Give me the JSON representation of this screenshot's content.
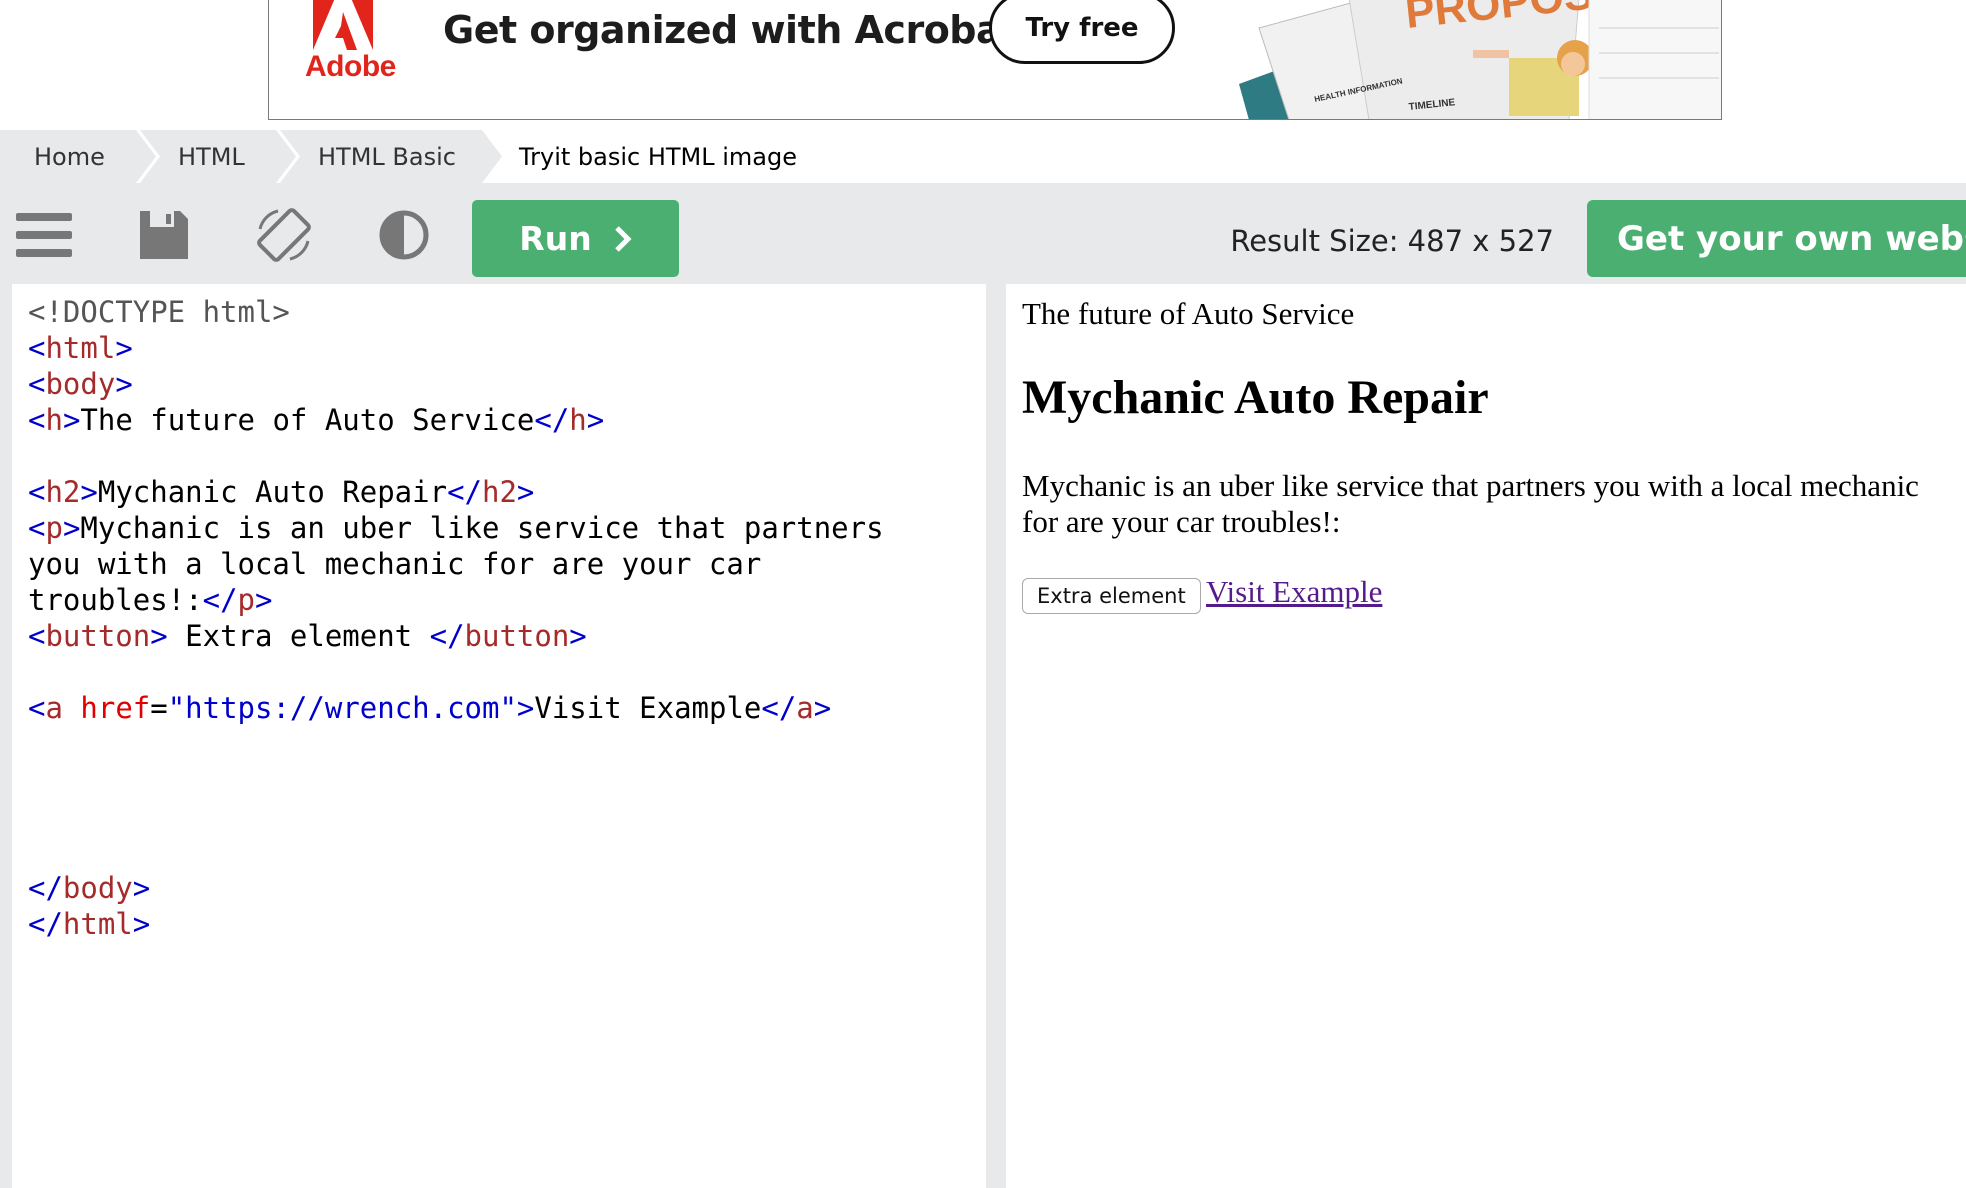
{
  "ad": {
    "brand": "Adobe",
    "headline": "Get organized with Acrobat.",
    "cta": "Try free",
    "art_title": "PROPOSAL",
    "art_timeline": "TIMELINE",
    "art_health": "HEALTH INFORMATION"
  },
  "breadcrumb": {
    "items": [
      "Home",
      "HTML",
      "HTML Basic",
      "Tryit basic HTML image"
    ]
  },
  "toolbar": {
    "icons": [
      "menu-icon",
      "save-icon",
      "rotate-icon",
      "contrast-icon"
    ],
    "run_label": "Run",
    "result_size": "Result Size: 487 x 527",
    "own_website_label": "Get your own website"
  },
  "code": {
    "lines": [
      "<!DOCTYPE html>",
      "<html>",
      "<body>",
      "<h>The future of Auto Service</h>",
      "",
      "<h2>Mychanic Auto Repair</h2>",
      "<p>Mychanic is an uber like service that partners",
      "you with a local mechanic for are your car",
      "troubles!:</p>",
      "<button> Extra element </button>",
      "",
      "<a href=\"https://wrench.com\">Visit Example</a>",
      "",
      "",
      "",
      "",
      "</body>",
      "</html>"
    ]
  },
  "result": {
    "h": "The future of Auto Service",
    "h2": "Mychanic Auto Repair",
    "p": "Mychanic is an uber like service that partners you with a local mechanic for are your car troubles!:",
    "button": "Extra element",
    "link": "Visit Example"
  },
  "colors": {
    "green": "#4caf72",
    "toolbar_bg": "#e7e9eb",
    "tag": "#0000cd",
    "tag_name": "#a52a2a",
    "attr": "#e00000",
    "link": "#551a8b",
    "adobe_red": "#e1251b"
  }
}
